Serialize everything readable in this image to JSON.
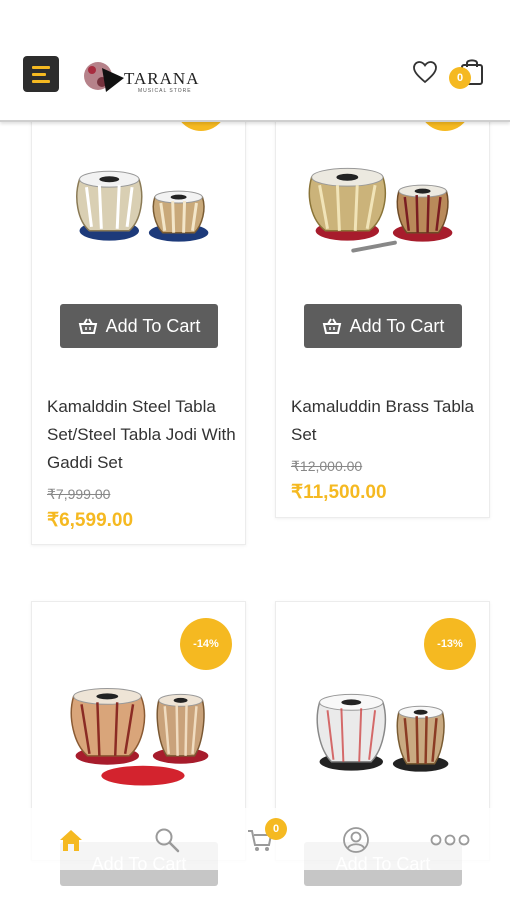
{
  "header": {
    "menu_icon": "menu-icon",
    "logo_text": "TARANA",
    "logo_subtext": "MUSICAL STORE",
    "wishlist_icon": "heart-icon",
    "bag_icon": "shopping-bag-icon",
    "bag_count": "0"
  },
  "products": [
    {
      "badge": "",
      "name": "Kamalddin Steel Tabla Set/Steel Tabla Jodi With Gaddi Set",
      "old_price": "₹7,999.00",
      "price": "₹6,599.00",
      "button_label": "Add To Cart"
    },
    {
      "badge": "",
      "name": "Kamaluddin Brass Tabla Set",
      "old_price": "₹12,000.00",
      "price": "₹11,500.00",
      "button_label": "Add To Cart"
    },
    {
      "badge": "-14%",
      "button_label": "Add To Cart"
    },
    {
      "badge": "-13%",
      "button_label": "Add To Cart"
    }
  ],
  "bottom_nav": {
    "home_icon": "home-icon",
    "search_icon": "search-icon",
    "cart_icon": "cart-icon",
    "cart_count": "0",
    "account_icon": "account-icon",
    "more_icon": "more-icon"
  },
  "colors": {
    "accent": "#f5b921",
    "button": "#5d5d5d",
    "menu_bg": "#2d2d2d"
  }
}
